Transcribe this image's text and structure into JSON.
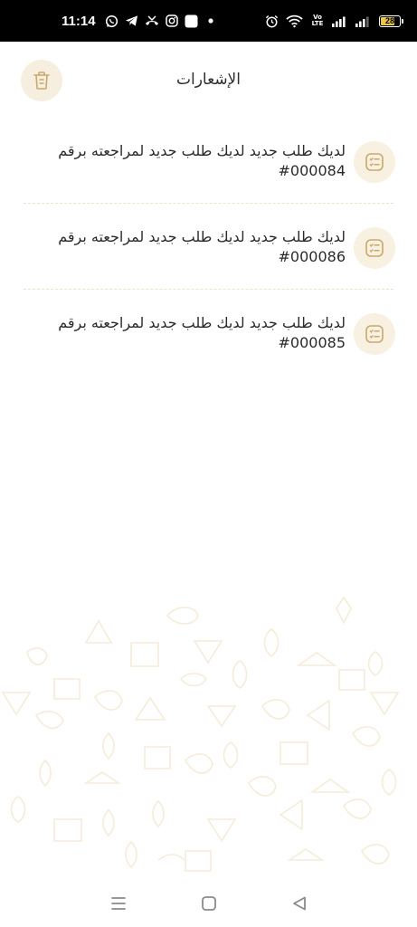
{
  "status_bar": {
    "time": "11:14",
    "battery": "28",
    "network_label": "Vo LTE",
    "left_icons": [
      "whatsapp-icon",
      "telegram-icon",
      "missed-call-icon",
      "instagram-icon",
      "app-square-icon",
      "dot-icon"
    ],
    "right_icons": [
      "alarm-icon",
      "wifi-icon",
      "volte-icon",
      "signal-icon",
      "signal-icon",
      "battery-icon"
    ]
  },
  "header": {
    "title": "الإشعارات",
    "delete_icon": "trash-icon"
  },
  "notifications": [
    {
      "message": "لديك طلب جديد لديك طلب جديد لمراجعته برقم",
      "number": "#000084",
      "icon": "checklist-icon"
    },
    {
      "message": "لديك طلب جديد لديك طلب جديد لمراجعته برقم",
      "number": "#000086",
      "icon": "checklist-icon"
    },
    {
      "message": "لديك طلب جديد لديك طلب جديد لمراجعته برقم",
      "number": "#000085",
      "icon": "checklist-icon"
    }
  ],
  "colors": {
    "accent": "#c9a96a",
    "badge_bg": "#f8f0e0",
    "divider": "#efe3c7",
    "pattern": "#f5ecd9"
  },
  "nav_bar": {
    "icons": [
      "menu-icon",
      "home-icon",
      "back-icon"
    ]
  }
}
